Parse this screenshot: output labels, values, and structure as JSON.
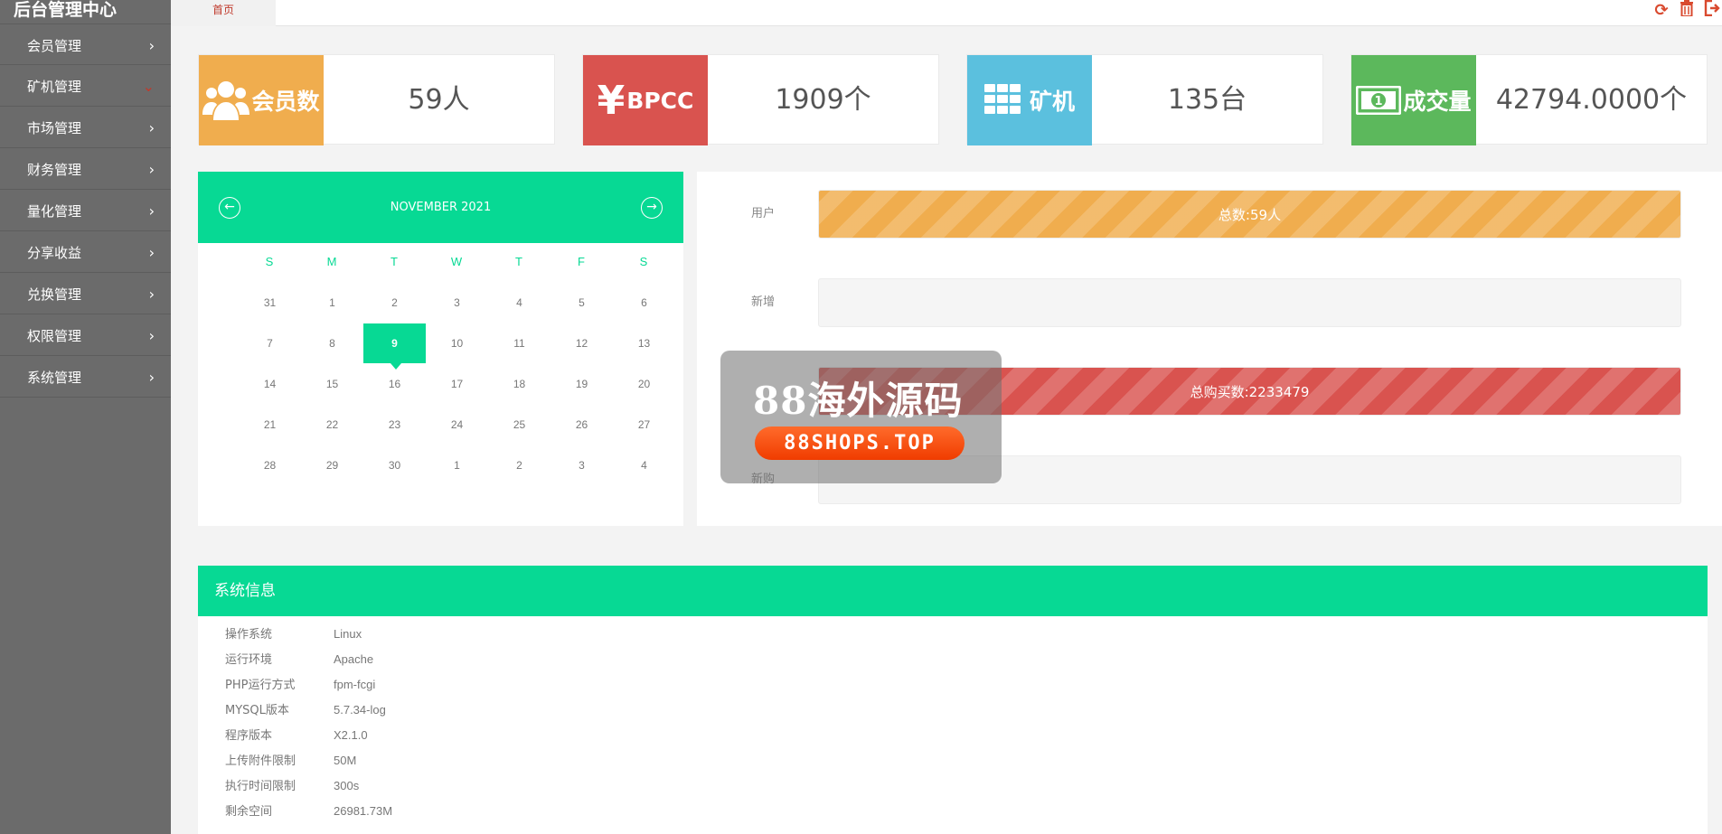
{
  "app": {
    "title": "后台管理中心"
  },
  "sidebar": {
    "items": [
      {
        "label": "会员管理"
      },
      {
        "label": "矿机管理"
      },
      {
        "label": "市场管理"
      },
      {
        "label": "财务管理"
      },
      {
        "label": "量化管理"
      },
      {
        "label": "分享收益"
      },
      {
        "label": "兑换管理"
      },
      {
        "label": "权限管理"
      },
      {
        "label": "系统管理"
      }
    ]
  },
  "topbar": {
    "home_tab": "首页"
  },
  "icons": {
    "refresh": "refresh-icon",
    "trash": "trash-icon",
    "logout": "logout-icon"
  },
  "stats": [
    {
      "label": "会员数",
      "value": "59人",
      "icon": "users-icon",
      "color": "#f0ad4e"
    },
    {
      "label": "BPCC",
      "symbol": "¥",
      "value": "1909个",
      "icon": "yen-icon",
      "color": "#d9534f"
    },
    {
      "label": "矿机",
      "value": "135台",
      "icon": "grid-icon",
      "color": "#5bc0de"
    },
    {
      "label": "成交量",
      "value": "42794.0000个",
      "icon": "money-icon",
      "color": "#5cb85c"
    }
  ],
  "calendar": {
    "month": "NOVEMBER 2021",
    "weekdays": [
      "S",
      "M",
      "T",
      "W",
      "T",
      "F",
      "S"
    ],
    "weeks": [
      [
        "31",
        "1",
        "2",
        "3",
        "4",
        "5",
        "6"
      ],
      [
        "7",
        "8",
        "9",
        "10",
        "11",
        "12",
        "13"
      ],
      [
        "14",
        "15",
        "16",
        "17",
        "18",
        "19",
        "20"
      ],
      [
        "21",
        "22",
        "23",
        "24",
        "25",
        "26",
        "27"
      ],
      [
        "28",
        "29",
        "30",
        "1",
        "2",
        "3",
        "4"
      ]
    ],
    "today": "9"
  },
  "progress": [
    {
      "label": "用户",
      "text": "总数:59人",
      "fill": 1.0,
      "color": "orange"
    },
    {
      "label": "新增",
      "text": "",
      "fill": 0.0,
      "color": "orange"
    },
    {
      "label": "",
      "text": "总购买数:2233479",
      "fill": 1.0,
      "color": "red"
    },
    {
      "label": "新购",
      "text": "",
      "fill": 0.0,
      "color": "red"
    }
  ],
  "system": {
    "title": "系统信息",
    "rows": [
      {
        "k": "操作系统",
        "v": "Linux"
      },
      {
        "k": "运行环境",
        "v": "Apache"
      },
      {
        "k": "PHP运行方式",
        "v": "fpm-fcgi"
      },
      {
        "k": "MYSQL版本",
        "v": "5.7.34-log"
      },
      {
        "k": "程序版本",
        "v": "X2.1.0"
      },
      {
        "k": "上传附件限制",
        "v": "50M"
      },
      {
        "k": "执行时间限制",
        "v": "300s"
      },
      {
        "k": "剩余空间",
        "v": "26981.73M"
      }
    ]
  },
  "watermark": {
    "title": "88海外源码",
    "site": "88SHOPS.TOP"
  }
}
